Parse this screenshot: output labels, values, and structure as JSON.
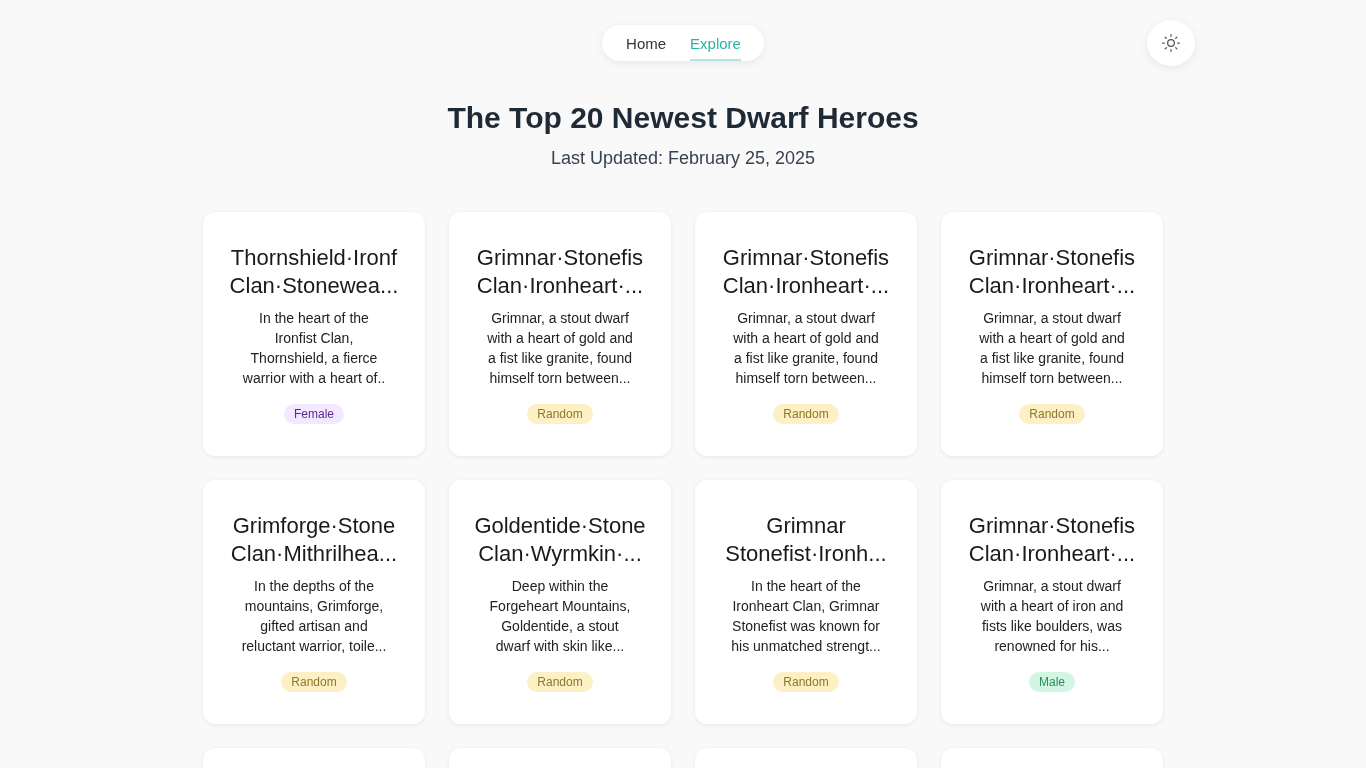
{
  "nav": {
    "items": [
      {
        "label": "Home",
        "selected": false
      },
      {
        "label": "Explore",
        "selected": true
      }
    ]
  },
  "page": {
    "title": "The Top 20 Newest Dwarf Heroes",
    "subtitle": "Last Updated: February 25, 2025"
  },
  "cards": [
    {
      "kind": "hero",
      "title_lines": [
        "Thornshield·Ironf",
        "Clan·Stonewea..."
      ],
      "description_lines": [
        "In the heart of the",
        "Ironfist Clan,",
        "Thornshield, a fierce",
        "warrior with a heart of.."
      ],
      "badge": {
        "label": "Female",
        "color": "#f3e8ff"
      }
    },
    {
      "kind": "hero",
      "title_lines": [
        "Grimnar·Stonefis",
        "Clan·Ironheart·..."
      ],
      "description_lines": [
        "Grimnar, a stout dwarf",
        "with a heart of gold and",
        "a fist like granite, found",
        "himself torn between..."
      ],
      "badge": {
        "label": "Random",
        "color": "#fdf0c4"
      }
    },
    {
      "kind": "hero",
      "title_lines": [
        "Grimnar·Stonefis",
        "Clan·Ironheart·..."
      ],
      "description_lines": [
        "Grimnar, a stout dwarf",
        "with a heart of gold and",
        "a fist like granite, found",
        "himself torn between..."
      ],
      "badge": {
        "label": "Random",
        "color": "#fdf0c4"
      }
    },
    {
      "kind": "hero",
      "title_lines": [
        "Grimnar·Stonefis",
        "Clan·Ironheart·..."
      ],
      "description_lines": [
        "Grimnar, a stout dwarf",
        "with a heart of gold and",
        "a fist like granite, found",
        "himself torn between..."
      ],
      "badge": {
        "label": "Random",
        "color": "#fdf0c4"
      }
    },
    {
      "kind": "hero",
      "title_lines": [
        "Grimforge·Stone",
        "Clan·Mithrilhea..."
      ],
      "description_lines": [
        "In the depths of the",
        "mountains, Grimforge,",
        "gifted artisan and",
        "reluctant warrior, toile..."
      ],
      "badge": {
        "label": "Random",
        "color": "#fdf0c4"
      }
    },
    {
      "kind": "hero",
      "title_lines": [
        "Goldentide·Stone",
        "Clan·Wyrmkin·..."
      ],
      "description_lines": [
        "Deep within the",
        "Forgeheart Mountains,",
        "Goldentide, a stout",
        "dwarf with skin like..."
      ],
      "badge": {
        "label": "Random",
        "color": "#fdf0c4"
      }
    },
    {
      "kind": "hero",
      "title_lines": [
        "Grimnar",
        "Stonefist·Ironh..."
      ],
      "description_lines": [
        "In the heart of the",
        "Ironheart Clan, Grimnar",
        "Stonefist was known for",
        "his unmatched strengt..."
      ],
      "badge": {
        "label": "Random",
        "color": "#fdf0c4"
      }
    },
    {
      "kind": "hero",
      "title_lines": [
        "Grimnar·Stonefis",
        "Clan·Ironheart·..."
      ],
      "description_lines": [
        "Grimnar, a stout dwarf",
        "with a heart of iron and",
        "fists like boulders, was",
        "renowned for his..."
      ],
      "badge": {
        "label": "Male",
        "color": "#d3f5e3"
      }
    },
    {
      "kind": "clipped"
    },
    {
      "kind": "clipped"
    },
    {
      "kind": "clipped"
    },
    {
      "kind": "clipped"
    }
  ]
}
